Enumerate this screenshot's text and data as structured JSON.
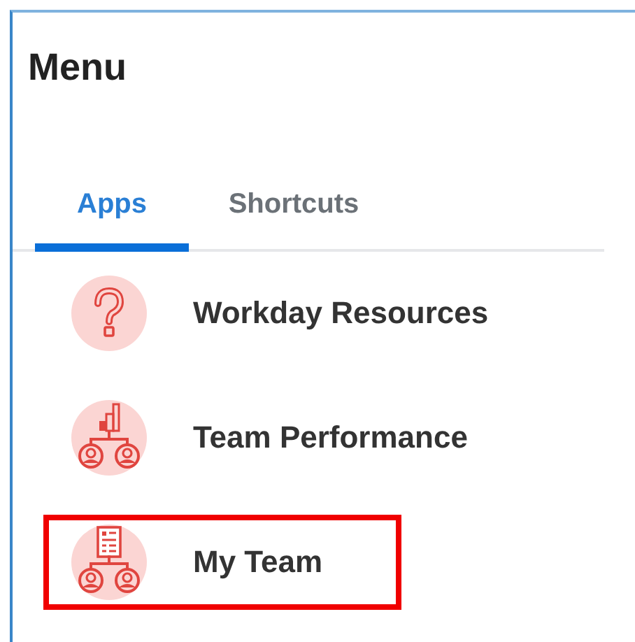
{
  "title": "Menu",
  "tabs": [
    {
      "label": "Apps",
      "selected": true
    },
    {
      "label": "Shortcuts",
      "selected": false
    }
  ],
  "apps": [
    {
      "label": "Workday Resources",
      "kind": "help",
      "highlighted": false
    },
    {
      "label": "Team Performance",
      "kind": "performance",
      "highlighted": false
    },
    {
      "label": "My Team",
      "kind": "team",
      "highlighted": true
    }
  ]
}
